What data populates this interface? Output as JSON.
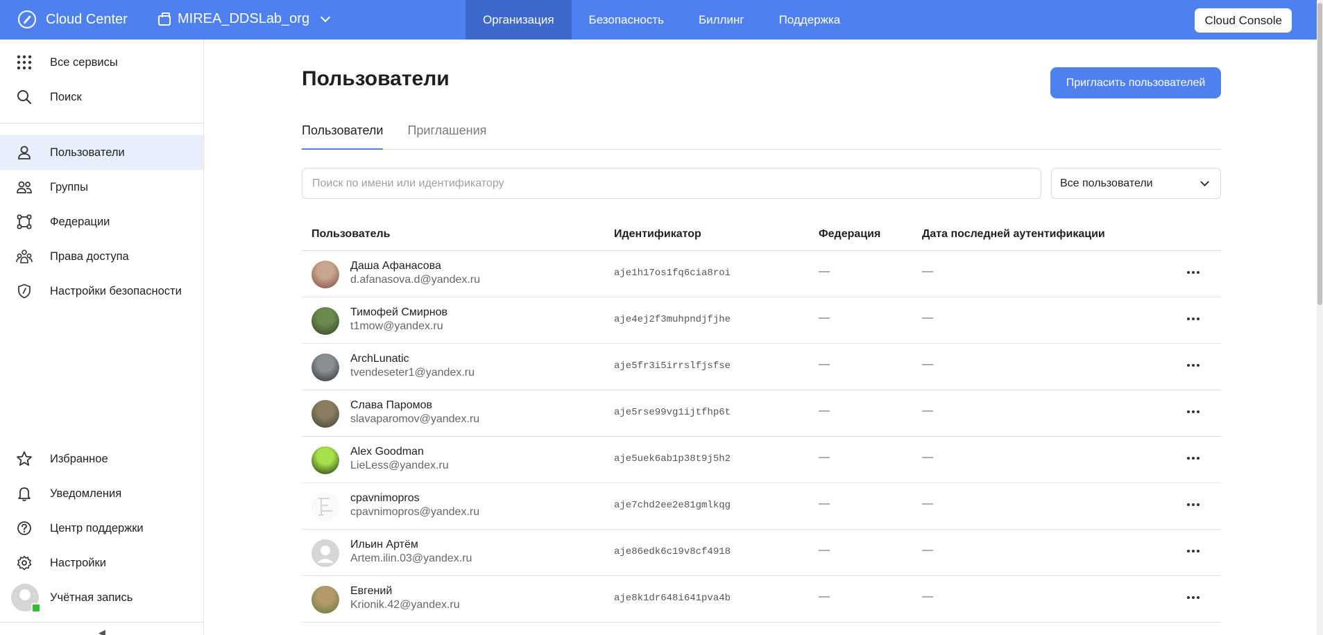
{
  "topbar": {
    "brand": "Cloud Center",
    "org": "MIREA_DDSLab_org",
    "nav": [
      "Организация",
      "Безопасность",
      "Биллинг",
      "Поддержка"
    ],
    "active_nav": 0,
    "console_label": "Cloud Console",
    "accent": "#4f80f0"
  },
  "sidebar": {
    "top": [
      {
        "label": "Все сервисы",
        "icon": "grid-icon"
      },
      {
        "label": "Поиск",
        "icon": "search-icon"
      }
    ],
    "main": [
      {
        "label": "Пользователи",
        "icon": "user-icon",
        "active": true
      },
      {
        "label": "Группы",
        "icon": "group-icon"
      },
      {
        "label": "Федерации",
        "icon": "federation-icon"
      },
      {
        "label": "Права доступа",
        "icon": "access-icon"
      },
      {
        "label": "Настройки безопасности",
        "icon": "shield-icon"
      }
    ],
    "bottom": [
      {
        "label": "Избранное",
        "icon": "star-icon"
      },
      {
        "label": "Уведомления",
        "icon": "bell-icon"
      },
      {
        "label": "Центр поддержки",
        "icon": "help-icon"
      },
      {
        "label": "Настройки",
        "icon": "gear-icon"
      },
      {
        "label": "Учётная запись",
        "icon": "account-avatar"
      }
    ],
    "collapse_glyph": "◀"
  },
  "main": {
    "title": "Пользователи",
    "invite_label": "Пригласить пользователей",
    "tabs": [
      "Пользователи",
      "Приглашения"
    ],
    "search_placeholder": "Поиск по имени или идентификатору",
    "filter_value": "Все пользователи",
    "columns": [
      "Пользователь",
      "Идентификатор",
      "Федерация",
      "Дата последней аутентификации"
    ],
    "users": [
      {
        "name": "Даша Афанасова",
        "email": "d.afanasova.d@yandex.ru",
        "id": "aje1h17os1fq6cia8roi",
        "federation": "—",
        "last_auth": "—",
        "avatar_colors": [
          "#c9a48e",
          "#7a4a3c"
        ]
      },
      {
        "name": "Тимофей Смирнов",
        "email": "t1mow@yandex.ru",
        "id": "aje4ej2f3muhpndjfjhe",
        "federation": "—",
        "last_auth": "—",
        "avatar_colors": [
          "#6b8a4e",
          "#2e3f22"
        ]
      },
      {
        "name": "ArchLunatic",
        "email": "tvendeseter1@yandex.ru",
        "id": "aje5fr3i5irrslfjsfse",
        "federation": "—",
        "last_auth": "—",
        "avatar_colors": [
          "#8a8f94",
          "#2c2f33"
        ]
      },
      {
        "name": "Слава Паромов",
        "email": "slavaparomov@yandex.ru",
        "id": "aje5rse99vg1ijtfhp6t",
        "federation": "—",
        "last_auth": "—",
        "avatar_colors": [
          "#8b7d62",
          "#3a4233"
        ]
      },
      {
        "name": "Alex Goodman",
        "email": "LieLess@yandex.ru",
        "id": "aje5uek6ab1p38t9j5h2",
        "federation": "—",
        "last_auth": "—",
        "avatar_colors": [
          "#a6e04a",
          "#1e2a10"
        ]
      },
      {
        "name": "cpavnimopros",
        "email": "cpavnimopros@yandex.ru",
        "id": "aje7chd2ee2e81gmlkqg",
        "federation": "—",
        "last_auth": "—",
        "avatar_colors": [
          "#f2f2f2",
          "#d4d4d4"
        ]
      },
      {
        "name": "Ильин Артём",
        "email": "Artem.ilin.03@yandex.ru",
        "id": "aje86edk6c19v8cf4918",
        "federation": "—",
        "last_auth": "—",
        "avatar_colors": [
          "#d6d6d6",
          "#d6d6d6"
        ]
      },
      {
        "name": "Евгений",
        "email": "Krionik.42@yandex.ru",
        "id": "aje8k1dr648i641pva4b",
        "federation": "—",
        "last_auth": "—",
        "avatar_colors": [
          "#b39a6a",
          "#5f7a3a"
        ]
      }
    ]
  }
}
